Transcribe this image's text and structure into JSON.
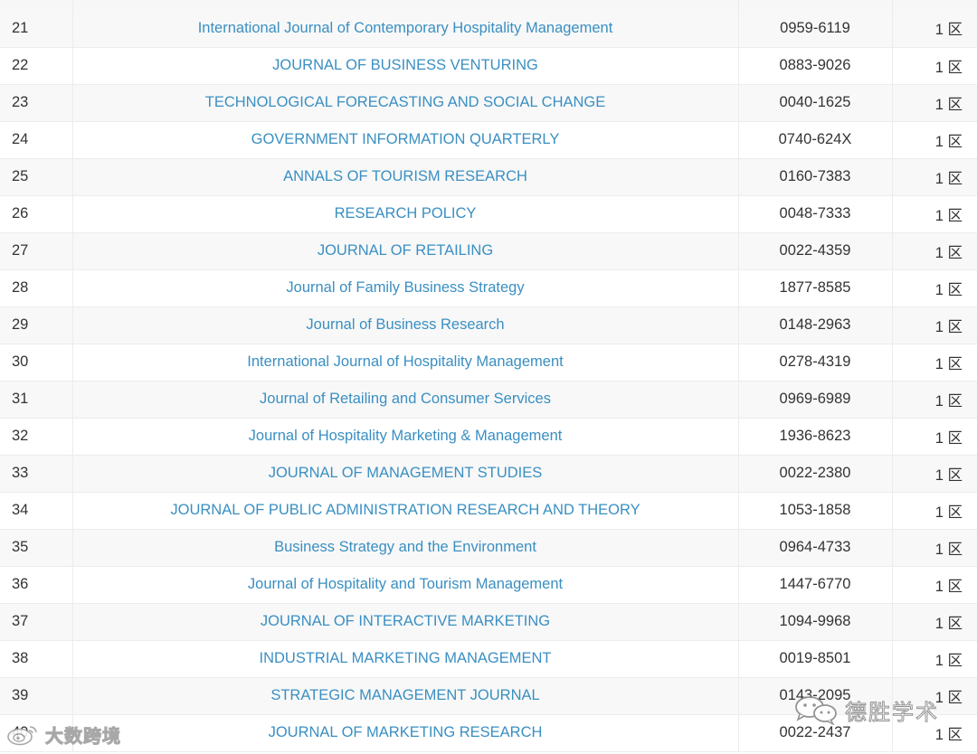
{
  "table": {
    "rows": [
      {
        "rank": "21",
        "name": "International Journal of Contemporary Hospitality Management",
        "issn": "0959-6119",
        "zone": "1 区"
      },
      {
        "rank": "22",
        "name": "JOURNAL OF BUSINESS VENTURING",
        "issn": "0883-9026",
        "zone": "1 区"
      },
      {
        "rank": "23",
        "name": "TECHNOLOGICAL FORECASTING AND SOCIAL CHANGE",
        "issn": "0040-1625",
        "zone": "1 区"
      },
      {
        "rank": "24",
        "name": "GOVERNMENT INFORMATION QUARTERLY",
        "issn": "0740-624X",
        "zone": "1 区"
      },
      {
        "rank": "25",
        "name": "ANNALS OF TOURISM RESEARCH",
        "issn": "0160-7383",
        "zone": "1 区"
      },
      {
        "rank": "26",
        "name": "RESEARCH POLICY",
        "issn": "0048-7333",
        "zone": "1 区"
      },
      {
        "rank": "27",
        "name": "JOURNAL OF RETAILING",
        "issn": "0022-4359",
        "zone": "1 区"
      },
      {
        "rank": "28",
        "name": "Journal of Family Business Strategy",
        "issn": "1877-8585",
        "zone": "1 区"
      },
      {
        "rank": "29",
        "name": "Journal of Business Research",
        "issn": "0148-2963",
        "zone": "1 区"
      },
      {
        "rank": "30",
        "name": "International Journal of Hospitality Management",
        "issn": "0278-4319",
        "zone": "1 区"
      },
      {
        "rank": "31",
        "name": "Journal of Retailing and Consumer Services",
        "issn": "0969-6989",
        "zone": "1 区"
      },
      {
        "rank": "32",
        "name": "Journal of Hospitality Marketing & Management",
        "issn": "1936-8623",
        "zone": "1 区"
      },
      {
        "rank": "33",
        "name": "JOURNAL OF MANAGEMENT STUDIES",
        "issn": "0022-2380",
        "zone": "1 区"
      },
      {
        "rank": "34",
        "name": "JOURNAL OF PUBLIC ADMINISTRATION RESEARCH AND THEORY",
        "issn": "1053-1858",
        "zone": "1 区"
      },
      {
        "rank": "35",
        "name": "Business Strategy and the Environment",
        "issn": "0964-4733",
        "zone": "1 区"
      },
      {
        "rank": "36",
        "name": "Journal of Hospitality and Tourism Management",
        "issn": "1447-6770",
        "zone": "1 区"
      },
      {
        "rank": "37",
        "name": "JOURNAL OF INTERACTIVE MARKETING",
        "issn": "1094-9968",
        "zone": "1 区"
      },
      {
        "rank": "38",
        "name": "INDUSTRIAL MARKETING MANAGEMENT",
        "issn": "0019-8501",
        "zone": "1 区"
      },
      {
        "rank": "39",
        "name": "STRATEGIC MANAGEMENT JOURNAL",
        "issn": "0143-2095",
        "zone": "1 区"
      },
      {
        "rank": "40",
        "name": "JOURNAL OF MARKETING RESEARCH",
        "issn": "0022-2437",
        "zone": "1 区"
      }
    ]
  },
  "watermarks": {
    "left_text": "大数跨境",
    "left_icon": "weibo-logo-icon",
    "right_text": "德胜学术",
    "right_icon": "wechat-logo-icon"
  },
  "colors": {
    "link": "#3a8fc2",
    "text": "#333333",
    "row_stripe": "#f8f8f8",
    "border": "#ececec"
  }
}
